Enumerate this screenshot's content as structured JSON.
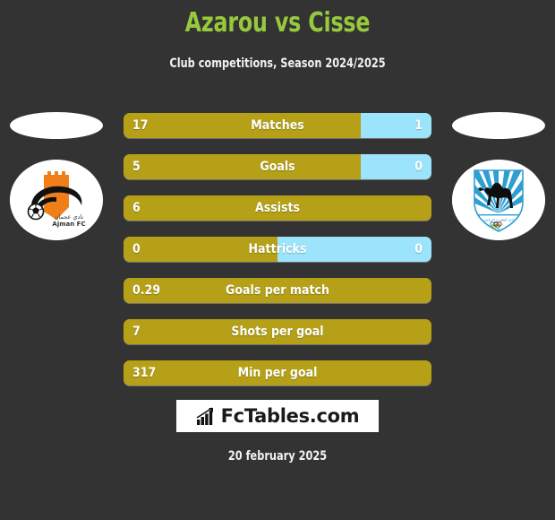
{
  "header": {
    "title": "Azarou vs Cisse",
    "subtitle": "Club competitions, Season 2024/2025",
    "title_color": "#97c93d",
    "subtitle_color": "#f2f2f2"
  },
  "theme": {
    "background": "#333333",
    "home_bar_color": "#b5a018",
    "away_bar_color": "#9be4fb",
    "value_text_color": "#ffffff"
  },
  "home_team": {
    "badge_name": "ajman-fc-badge",
    "badge_label": "Ajman FC",
    "badge_arabic": "نادي عجمان",
    "photo_placeholder": "player-photo-left"
  },
  "away_team": {
    "badge_name": "camel-shield-badge",
    "badge_label": "Al Dhafra",
    "photo_placeholder": "player-photo-right"
  },
  "stats": [
    {
      "label": "Matches",
      "home": "17",
      "away": "1",
      "home_pct": 77,
      "has_away": true
    },
    {
      "label": "Goals",
      "home": "5",
      "away": "0",
      "home_pct": 77,
      "has_away": true
    },
    {
      "label": "Assists",
      "home": "6",
      "away": "",
      "home_pct": 100,
      "has_away": false
    },
    {
      "label": "Hattricks",
      "home": "0",
      "away": "0",
      "home_pct": 50,
      "has_away": true
    },
    {
      "label": "Goals per match",
      "home": "0.29",
      "away": "",
      "home_pct": 100,
      "has_away": false
    },
    {
      "label": "Shots per goal",
      "home": "7",
      "away": "",
      "home_pct": 100,
      "has_away": false
    },
    {
      "label": "Min per goal",
      "home": "317",
      "away": "",
      "home_pct": 100,
      "has_away": false
    }
  ],
  "footer": {
    "brand": "FcTables.com",
    "brand_icon": "bar-chart-icon",
    "date": "20 february 2025"
  }
}
